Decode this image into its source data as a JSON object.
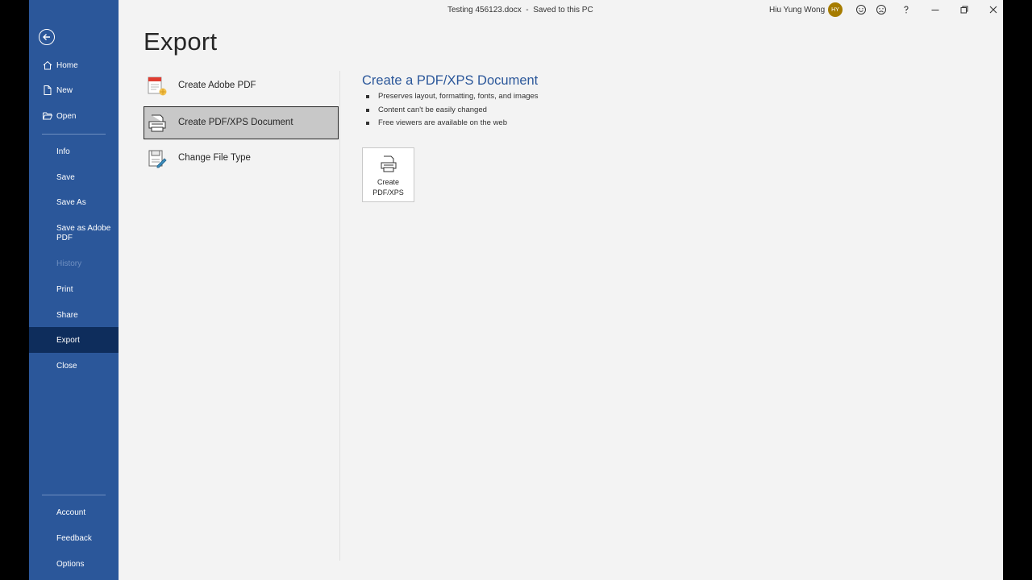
{
  "titlebar": {
    "doc_name": "Testing 456123.docx",
    "save_state": "Saved to this PC",
    "user_name": "Hiu Yung Wong",
    "user_initials": "HY"
  },
  "sidebar": {
    "home": "Home",
    "new": "New",
    "open": "Open",
    "info": "Info",
    "save": "Save",
    "save_as": "Save As",
    "save_as_adobe_line1": "Save as Adobe",
    "save_as_adobe_line2": "PDF",
    "history": "History",
    "print": "Print",
    "share": "Share",
    "export": "Export",
    "close": "Close",
    "account": "Account",
    "feedback": "Feedback",
    "options": "Options"
  },
  "main": {
    "title": "Export",
    "options": {
      "adobe": "Create Adobe PDF",
      "pdf_xps": "Create PDF/XPS Document",
      "change_type": "Change File Type"
    },
    "detail": {
      "heading": "Create a PDF/XPS Document",
      "bullet1": "Preserves layout, formatting, fonts, and images",
      "bullet2": "Content can't be easily changed",
      "bullet3": "Free viewers are available on the web",
      "button_line1": "Create",
      "button_line2": "PDF/XPS"
    }
  },
  "colors": {
    "sidebar_bg": "#2b579a",
    "sidebar_selected": "#0e2d5c",
    "accent_heading": "#2b579a",
    "avatar_bg": "#a67c00"
  }
}
